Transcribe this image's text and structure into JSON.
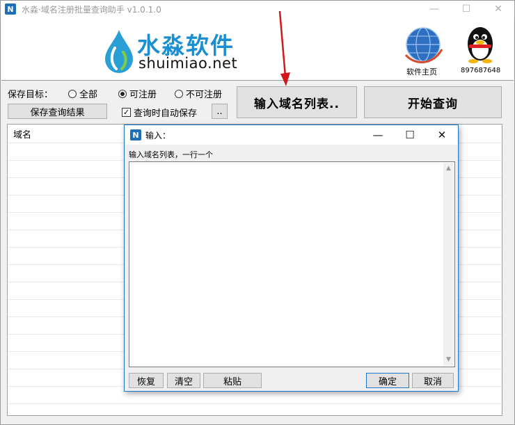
{
  "app": {
    "title": "水淼·域名注册批量查询助手 v1.0.1.0",
    "icon_glyph": "N",
    "window_controls": {
      "minimize": "—",
      "maximize": "☐",
      "close": "✕"
    }
  },
  "header": {
    "logo_cn": "水淼软件",
    "logo_en": "shuimiao.net",
    "home_label": "软件主页",
    "qq_label": "897687648"
  },
  "toolbar": {
    "save_target_label": "保存目标：",
    "radio_all": "全部",
    "radio_available": "可注册",
    "radio_unavailable": "不可注册",
    "selected_radio": "可注册",
    "save_results_button": "保存查询结果",
    "auto_save_label": "查询时自动保存",
    "auto_save_checked": true,
    "dots_button": "..",
    "input_list_button": "输入域名列表..",
    "start_button": "开始查询"
  },
  "results": {
    "column_domain": "域名"
  },
  "dialog": {
    "title": "输入：",
    "prompt": "输入域名列表，一行一个",
    "text_value": "",
    "window_controls": {
      "minimize": "—",
      "maximize": "☐",
      "close": "✕"
    },
    "buttons": {
      "restore": "恢复",
      "clear": "清空",
      "paste": "粘贴",
      "ok": "确定",
      "cancel": "取消"
    }
  },
  "colors": {
    "accent": "#1e78c8",
    "logo_blue": "#1b8fcf",
    "arrow_red": "#d0191a"
  }
}
